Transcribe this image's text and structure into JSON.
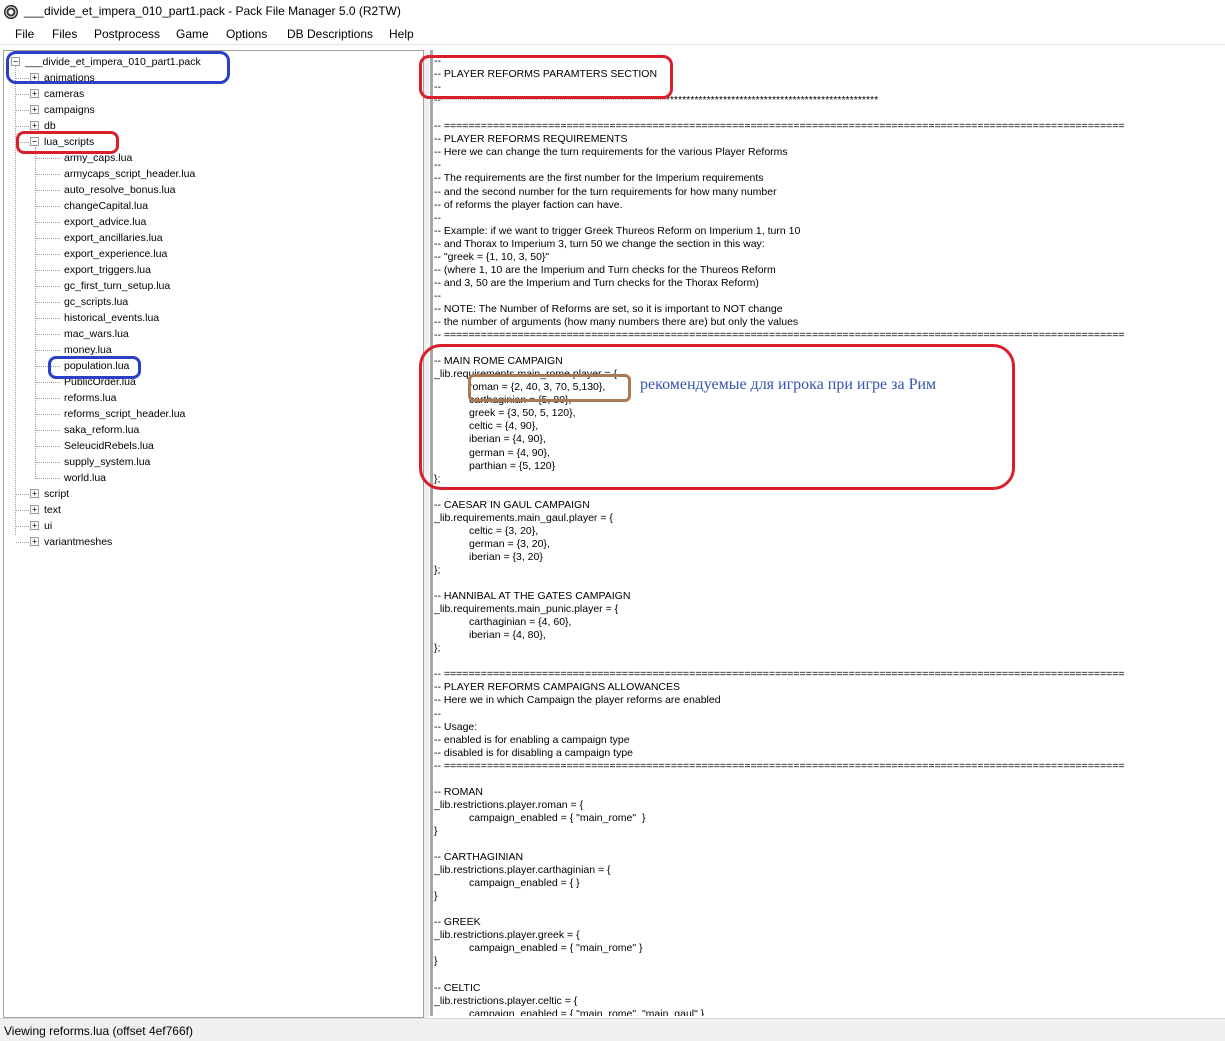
{
  "window": {
    "title": "___divide_et_impera_010_part1.pack - Pack File Manager 5.0 (R2TW)"
  },
  "menu": [
    "File",
    "Files",
    "Postprocess",
    "Game",
    "Options",
    "DB Descriptions",
    "Help"
  ],
  "tree": {
    "root": "___divide_et_impera_010_part1.pack",
    "folders_before": [
      "animations",
      "cameras",
      "campaigns",
      "db"
    ],
    "open_folder": "lua_scripts",
    "files": [
      "army_caps.lua",
      "armycaps_script_header.lua",
      "auto_resolve_bonus.lua",
      "changeCapital.lua",
      "export_advice.lua",
      "export_ancillaries.lua",
      "export_experience.lua",
      "export_triggers.lua",
      "gc_first_turn_setup.lua",
      "gc_scripts.lua",
      "historical_events.lua",
      "mac_wars.lua",
      "money.lua",
      "population.lua",
      "PublicOrder.lua",
      "reforms.lua",
      "reforms_script_header.lua",
      "saka_reform.lua",
      "SeleucidRebels.lua",
      "supply_system.lua",
      "world.lua"
    ],
    "folders_after": [
      "script",
      "text",
      "ui",
      "variantmeshes"
    ]
  },
  "code_lines": [
    "--",
    "-- PLAYER REFORMS PARAMTERS SECTION",
    "--",
    "--***********************************************************************************************************",
    "",
    "-- ===============================================================================================================",
    "-- PLAYER REFORMS REQUIREMENTS",
    "-- Here we can change the turn requirements for the various Player Reforms",
    "--",
    "-- The requirements are the first number for the Imperium requirements",
    "-- and the second number for the turn requirements for how many number",
    "-- of reforms the player faction can have.",
    "--",
    "-- Example: if we want to trigger Greek Thureos Reform on Imperium 1, turn 10",
    "-- and Thorax to Imperium 3, turn 50 we change the section in this way:",
    "-- \"greek = {1, 10, 3, 50}\"",
    "-- (where 1, 10 are the Imperium and Turn checks for the Thureos Reform",
    "-- and 3, 50 are the Imperium and Turn checks for the Thorax Reform)",
    "--",
    "-- NOTE: The Number of Reforms are set, so it is important to NOT change",
    "-- the number of arguments (how many numbers there are) but only the values",
    "-- ===============================================================================================================",
    "",
    "-- MAIN ROME CAMPAIGN",
    "_lib.requirements.main_rome.player = {",
    "            roman = {2, 40, 3, 70, 5,130},",
    "            carthaginian = {5, 80},",
    "            greek = {3, 50, 5, 120},",
    "            celtic = {4, 90},",
    "            iberian = {4, 90},",
    "            german = {4, 90},",
    "            parthian = {5, 120}",
    "};",
    "",
    "-- CAESAR IN GAUL CAMPAIGN",
    "_lib.requirements.main_gaul.player = {",
    "            celtic = {3, 20},",
    "            german = {3, 20},",
    "            iberian = {3, 20}",
    "};",
    "",
    "-- HANNIBAL AT THE GATES CAMPAIGN",
    "_lib.requirements.main_punic.player = {",
    "            carthaginian = {4, 60},",
    "            iberian = {4, 80},",
    "};",
    "",
    "-- ===============================================================================================================",
    "-- PLAYER REFORMS CAMPAIGNS ALLOWANCES",
    "-- Here we in which Campaign the player reforms are enabled",
    "--",
    "-- Usage:",
    "-- enabled is for enabling a campaign type",
    "-- disabled is for disabling a campaign type",
    "-- ===============================================================================================================",
    "",
    "-- ROMAN",
    "_lib.restrictions.player.roman = {",
    "            campaign_enabled = { \"main_rome\"  }",
    "}",
    "",
    "-- CARTHAGINIAN",
    "_lib.restrictions.player.carthaginian = {",
    "            campaign_enabled = { }",
    "}",
    "",
    "-- GREEK",
    "_lib.restrictions.player.greek = {",
    "            campaign_enabled = { \"main_rome\" }",
    "}",
    "",
    "-- CELTIC",
    "_lib.restrictions.player.celtic = {",
    "            campaign_enabled = { \"main_rome\", \"main_gaul\" }"
  ],
  "annotation_text": "рекомендуемые для игрока при игре за Рим",
  "status": "Viewing reforms.lua (offset 4ef766f)",
  "colors": {
    "highlight_blue": "#2b3fc7",
    "highlight_red": "#d8202c",
    "highlight_brown": "#a87a55",
    "annotation": "#3355aa"
  }
}
